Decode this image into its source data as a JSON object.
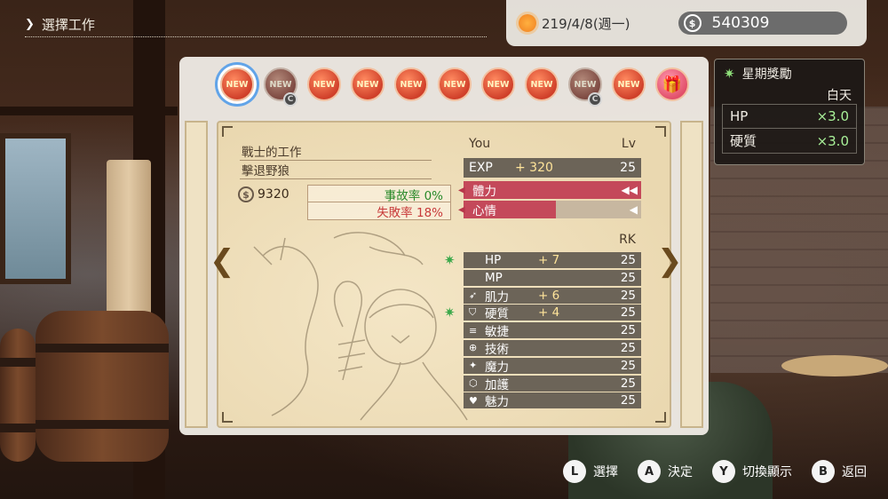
{
  "screen_title": "選擇工作",
  "date": "219/4/8(週一)",
  "money": "540309",
  "weekly_bonus": {
    "title": "星期獎勵",
    "time_of_day": "白天",
    "rows": [
      {
        "label": "HP",
        "mult": "×3.0"
      },
      {
        "label": "硬質",
        "mult": "×3.0"
      }
    ]
  },
  "job_badges": [
    {
      "label": "NEW",
      "selected": true,
      "dim": false,
      "sub": ""
    },
    {
      "label": "NEW",
      "selected": false,
      "dim": true,
      "sub": "C"
    },
    {
      "label": "NEW",
      "selected": false,
      "dim": false,
      "sub": ""
    },
    {
      "label": "NEW",
      "selected": false,
      "dim": false,
      "sub": ""
    },
    {
      "label": "NEW",
      "selected": false,
      "dim": false,
      "sub": ""
    },
    {
      "label": "NEW",
      "selected": false,
      "dim": false,
      "sub": ""
    },
    {
      "label": "NEW",
      "selected": false,
      "dim": false,
      "sub": ""
    },
    {
      "label": "NEW",
      "selected": false,
      "dim": false,
      "sub": ""
    },
    {
      "label": "NEW",
      "selected": false,
      "dim": true,
      "sub": "C"
    },
    {
      "label": "NEW",
      "selected": false,
      "dim": false,
      "sub": ""
    }
  ],
  "gift_icon": "gift-icon",
  "job": {
    "category": "戰士的工作",
    "name": "擊退野狼",
    "reward": "9320",
    "accident_rate": "事故率 0%",
    "failure_rate": "失敗率 18%"
  },
  "stats": {
    "col_you": "You",
    "col_lv": "Lv",
    "exp": {
      "label": "EXP",
      "gain": "+ 320",
      "lv": "25"
    },
    "stamina": {
      "label": "體力",
      "end": "◀◀",
      "fill": 1.0
    },
    "mood": {
      "label": "心情",
      "end": "◀",
      "fill": 0.52
    },
    "col_rk": "RK",
    "rows": [
      {
        "icon": "",
        "label": "HP",
        "gain": "+ 7",
        "rk": "25",
        "bonus": true
      },
      {
        "icon": "",
        "label": "MP",
        "gain": "",
        "rk": "25",
        "bonus": false
      },
      {
        "icon": "➶",
        "label": "肌力",
        "gain": "+ 6",
        "rk": "25",
        "bonus": false
      },
      {
        "icon": "⛉",
        "label": "硬質",
        "gain": "+ 4",
        "rk": "25",
        "bonus": true
      },
      {
        "icon": "≡",
        "label": "敏捷",
        "gain": "",
        "rk": "25",
        "bonus": false
      },
      {
        "icon": "⊕",
        "label": "技術",
        "gain": "",
        "rk": "25",
        "bonus": false
      },
      {
        "icon": "✦",
        "label": "魔力",
        "gain": "",
        "rk": "25",
        "bonus": false
      },
      {
        "icon": "⬡",
        "label": "加護",
        "gain": "",
        "rk": "25",
        "bonus": false
      },
      {
        "icon": "♥",
        "label": "魅力",
        "gain": "",
        "rk": "25",
        "bonus": false
      }
    ]
  },
  "controls": [
    {
      "button": "L",
      "label": "選擇"
    },
    {
      "button": "A",
      "label": "決定"
    },
    {
      "button": "Y",
      "label": "切換顯示"
    },
    {
      "button": "B",
      "label": "返回"
    }
  ]
}
